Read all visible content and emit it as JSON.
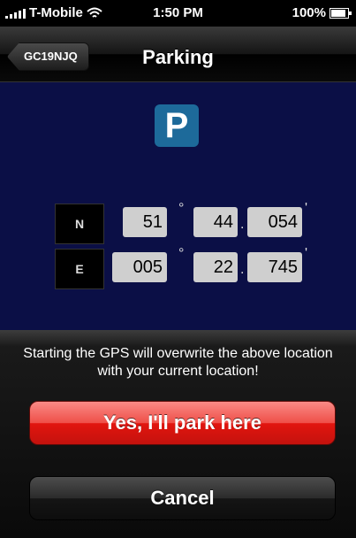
{
  "status_bar": {
    "carrier": "T-Mobile",
    "time": "1:50 PM",
    "battery": "100%"
  },
  "navbar": {
    "back_label": "GC19NJQ",
    "title": "Parking"
  },
  "icon": {
    "parking_letter": "P",
    "name": "parking-sign-icon"
  },
  "coordinates": {
    "lat": {
      "dir": "N",
      "deg": "51",
      "min": "44",
      "frac": "054"
    },
    "lon": {
      "dir": "E",
      "deg": "005",
      "min": "22",
      "frac": "745"
    },
    "degree_symbol": "°",
    "dot": ".",
    "minute_symbol": "'"
  },
  "action_sheet": {
    "message": "Starting the GPS will overwrite the above location with your current location!",
    "confirm_label": "Yes, I'll park here",
    "cancel_label": "Cancel"
  },
  "colors": {
    "background": "#0b0f46",
    "confirm": "#e2150f"
  }
}
